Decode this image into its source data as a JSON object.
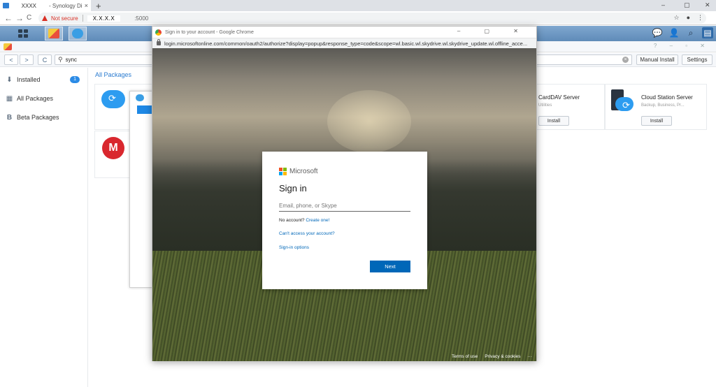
{
  "browser": {
    "tab_host": "XXXX",
    "tab_title": "- Synology Disk",
    "tab_close": "×",
    "newtab": "+",
    "win_controls": [
      "–",
      "▢",
      "✕"
    ],
    "nav": [
      "←",
      "→",
      "C"
    ],
    "not_secure": "Not secure",
    "url_host": "X.X.X.X",
    "url_port": ":5000",
    "omni_icons": [
      "☆",
      "●",
      "⋮"
    ]
  },
  "dsm": {
    "taskbar_icons": [
      "main-menu-icon",
      "package-center-icon",
      "cloud-sync-icon"
    ],
    "right_icons": [
      "notifications-icon",
      "user-icon",
      "search-icon",
      "widgets-icon"
    ]
  },
  "package_center": {
    "window_controls": "? – ▫ ✕",
    "nav_back": "<",
    "nav_forward": ">",
    "refresh": "C",
    "search_value": "sync",
    "manual_install": "Manual Install",
    "settings": "Settings",
    "sidebar": [
      {
        "label": "Installed",
        "icon": "download-icon",
        "badge": "1"
      },
      {
        "label": "All Packages",
        "icon": "grid-icon"
      },
      {
        "label": "Beta Packages",
        "icon": "beta-icon"
      }
    ],
    "section_title": "All Packages",
    "packages": [
      {
        "name": "CardDAV Server",
        "subtitle": "Utilities",
        "action": "Install"
      },
      {
        "name": "Cloud Station Server",
        "subtitle": "Backup, Business, Pr...",
        "action": "Install"
      }
    ],
    "mega_letter": "M"
  },
  "popup": {
    "title": "Sign in to your account - Google Chrome",
    "controls": "– ▢ ✕",
    "url": "login.microsoftonline.com/common/oauth2/authorize?display=popup&response_type=code&scope=wl.basic.wl.skydrive.wl.skydrive_update.wl.offline_acce...",
    "footer": [
      "Terms of use",
      "Privacy & cookies",
      "···"
    ]
  },
  "signin": {
    "brand": "Microsoft",
    "heading": "Sign in",
    "email_placeholder": "Email, phone, or Skype",
    "no_account": "No account?",
    "create_one": "Create one!",
    "cant_access": "Can't access your account?",
    "signin_options": "Sign-in options",
    "next": "Next"
  },
  "colors": {
    "accent": "#0067b8",
    "dsm_bar": "#6a94c0",
    "warning": "#d93025",
    "badge": "#2b8be6"
  }
}
